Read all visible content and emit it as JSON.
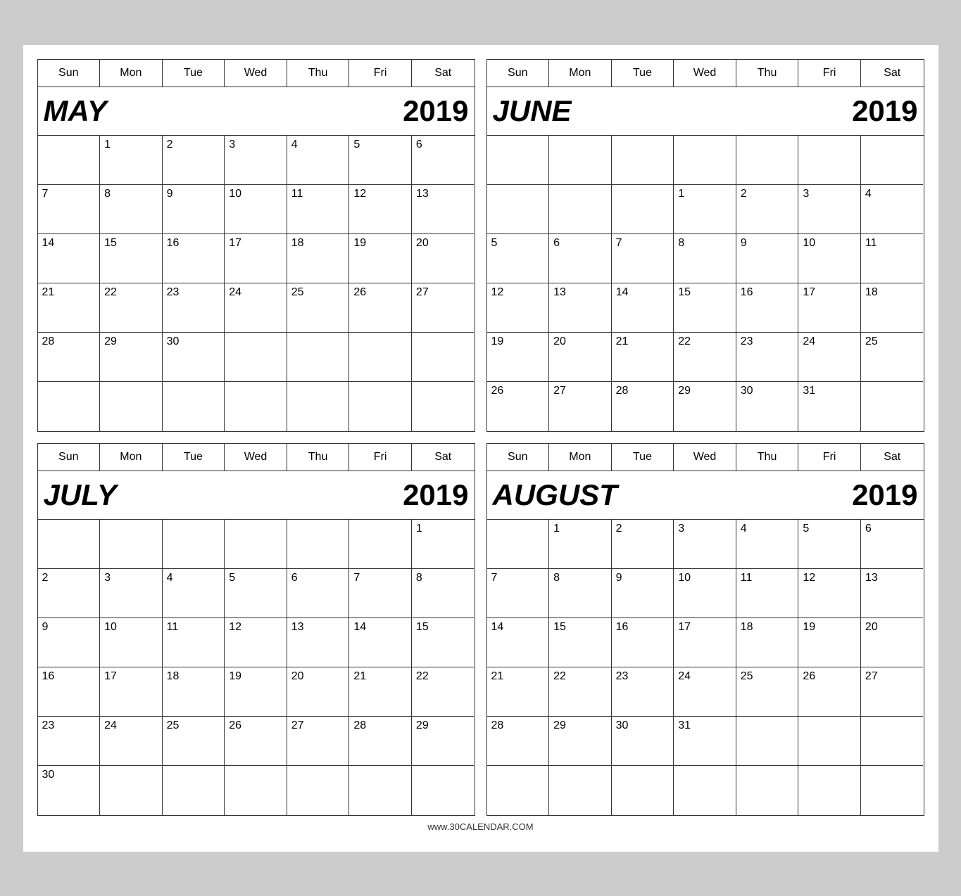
{
  "footer": "www.30CALENDAR.COM",
  "calendars": [
    {
      "id": "may-2019",
      "month": "MAY",
      "year": "2019",
      "days_of_week": [
        "Sun",
        "Mon",
        "Tue",
        "Wed",
        "Thu",
        "Fri",
        "Sat"
      ],
      "weeks": [
        [
          "",
          "1",
          "2",
          "3",
          "4",
          "5",
          "6"
        ],
        [
          "7",
          "8",
          "9",
          "10",
          "11",
          "12",
          "13"
        ],
        [
          "14",
          "15",
          "16",
          "17",
          "18",
          "19",
          "20"
        ],
        [
          "21",
          "22",
          "23",
          "24",
          "25",
          "26",
          "27"
        ],
        [
          "28",
          "29",
          "30",
          "",
          "",
          "",
          ""
        ],
        [
          "",
          "",
          "",
          "",
          "",
          "",
          ""
        ]
      ]
    },
    {
      "id": "june-2019",
      "month": "JUNE",
      "year": "2019",
      "days_of_week": [
        "Sun",
        "Mon",
        "Tue",
        "Wed",
        "Thu",
        "Fri",
        "Sat"
      ],
      "weeks": [
        [
          "",
          "",
          "",
          "",
          "",
          "",
          ""
        ],
        [
          "",
          "",
          "",
          "1",
          "2",
          "3",
          "4"
        ],
        [
          "5",
          "6",
          "7",
          "8",
          "9",
          "10",
          "11"
        ],
        [
          "12",
          "13",
          "14",
          "15",
          "16",
          "17",
          "18"
        ],
        [
          "19",
          "20",
          "21",
          "22",
          "23",
          "24",
          "25"
        ],
        [
          "26",
          "27",
          "28",
          "29",
          "30",
          "31",
          ""
        ]
      ]
    },
    {
      "id": "july-2019",
      "month": "JULY",
      "year": "2019",
      "days_of_week": [
        "Sun",
        "Mon",
        "Tue",
        "Wed",
        "Thu",
        "Fri",
        "Sat"
      ],
      "weeks": [
        [
          "",
          "",
          "",
          "",
          "",
          "",
          "1"
        ],
        [
          "2",
          "3",
          "4",
          "5",
          "6",
          "7",
          "8"
        ],
        [
          "9",
          "10",
          "11",
          "12",
          "13",
          "14",
          "15"
        ],
        [
          "16",
          "17",
          "18",
          "19",
          "20",
          "21",
          "22"
        ],
        [
          "23",
          "24",
          "25",
          "26",
          "27",
          "28",
          "29"
        ],
        [
          "30",
          "",
          "",
          "",
          "",
          "",
          ""
        ]
      ]
    },
    {
      "id": "august-2019",
      "month": "AUGUST",
      "year": "2019",
      "days_of_week": [
        "Sun",
        "Mon",
        "Tue",
        "Wed",
        "Thu",
        "Fri",
        "Sat"
      ],
      "weeks": [
        [
          "",
          "1",
          "2",
          "3",
          "4",
          "5",
          "6"
        ],
        [
          "7",
          "8",
          "9",
          "10",
          "11",
          "12",
          "13"
        ],
        [
          "14",
          "15",
          "16",
          "17",
          "18",
          "19",
          "20"
        ],
        [
          "21",
          "22",
          "23",
          "24",
          "25",
          "26",
          "27"
        ],
        [
          "28",
          "29",
          "30",
          "31",
          "",
          "",
          ""
        ],
        [
          "",
          "",
          "",
          "",
          "",
          "",
          ""
        ]
      ]
    }
  ]
}
